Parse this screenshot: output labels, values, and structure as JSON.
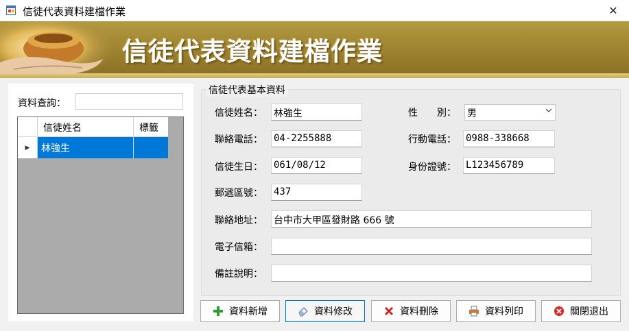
{
  "window": {
    "title": "信徒代表資料建檔作業",
    "close_glyph": "✕"
  },
  "banner": {
    "title": "信徒代表資料建檔作業"
  },
  "search": {
    "label": "資料查詢：",
    "value": ""
  },
  "grid": {
    "columns": [
      "信徒姓名",
      "標籤"
    ],
    "rows": [
      {
        "name": "林強生",
        "tag": "",
        "selected": true
      }
    ],
    "row_indicator": "▶"
  },
  "form": {
    "group_title": "信徒代表基本資料",
    "fields": {
      "name": {
        "label": "信徒姓名：",
        "value": "林強生"
      },
      "gender": {
        "label": "性　　別：",
        "value": "男"
      },
      "phone": {
        "label": "聯絡電話：",
        "value": "04-2255888"
      },
      "mobile": {
        "label": "行動電話：",
        "value": "0988-338668"
      },
      "birthday": {
        "label": "信徒生日：",
        "value": "061/08/12"
      },
      "id_no": {
        "label": "身份證號：",
        "value": "L123456789"
      },
      "zip": {
        "label": "郵遞區號：",
        "value": "437"
      },
      "address": {
        "label": "聯絡地址：",
        "value": "台中市大甲區發財路 666 號"
      },
      "email": {
        "label": "電子信箱：",
        "value": ""
      },
      "note": {
        "label": "備註說明：",
        "value": ""
      }
    }
  },
  "buttons": {
    "add": "資料新增",
    "edit": "資料修改",
    "delete": "資料刪除",
    "print": "資料列印",
    "exit": "關閉退出"
  },
  "colors": {
    "selection": "#0078d7",
    "banner": "#a08533",
    "add_icon": "#2e9c2e",
    "delete_icon": "#d02020",
    "exit_icon": "#e02424"
  }
}
